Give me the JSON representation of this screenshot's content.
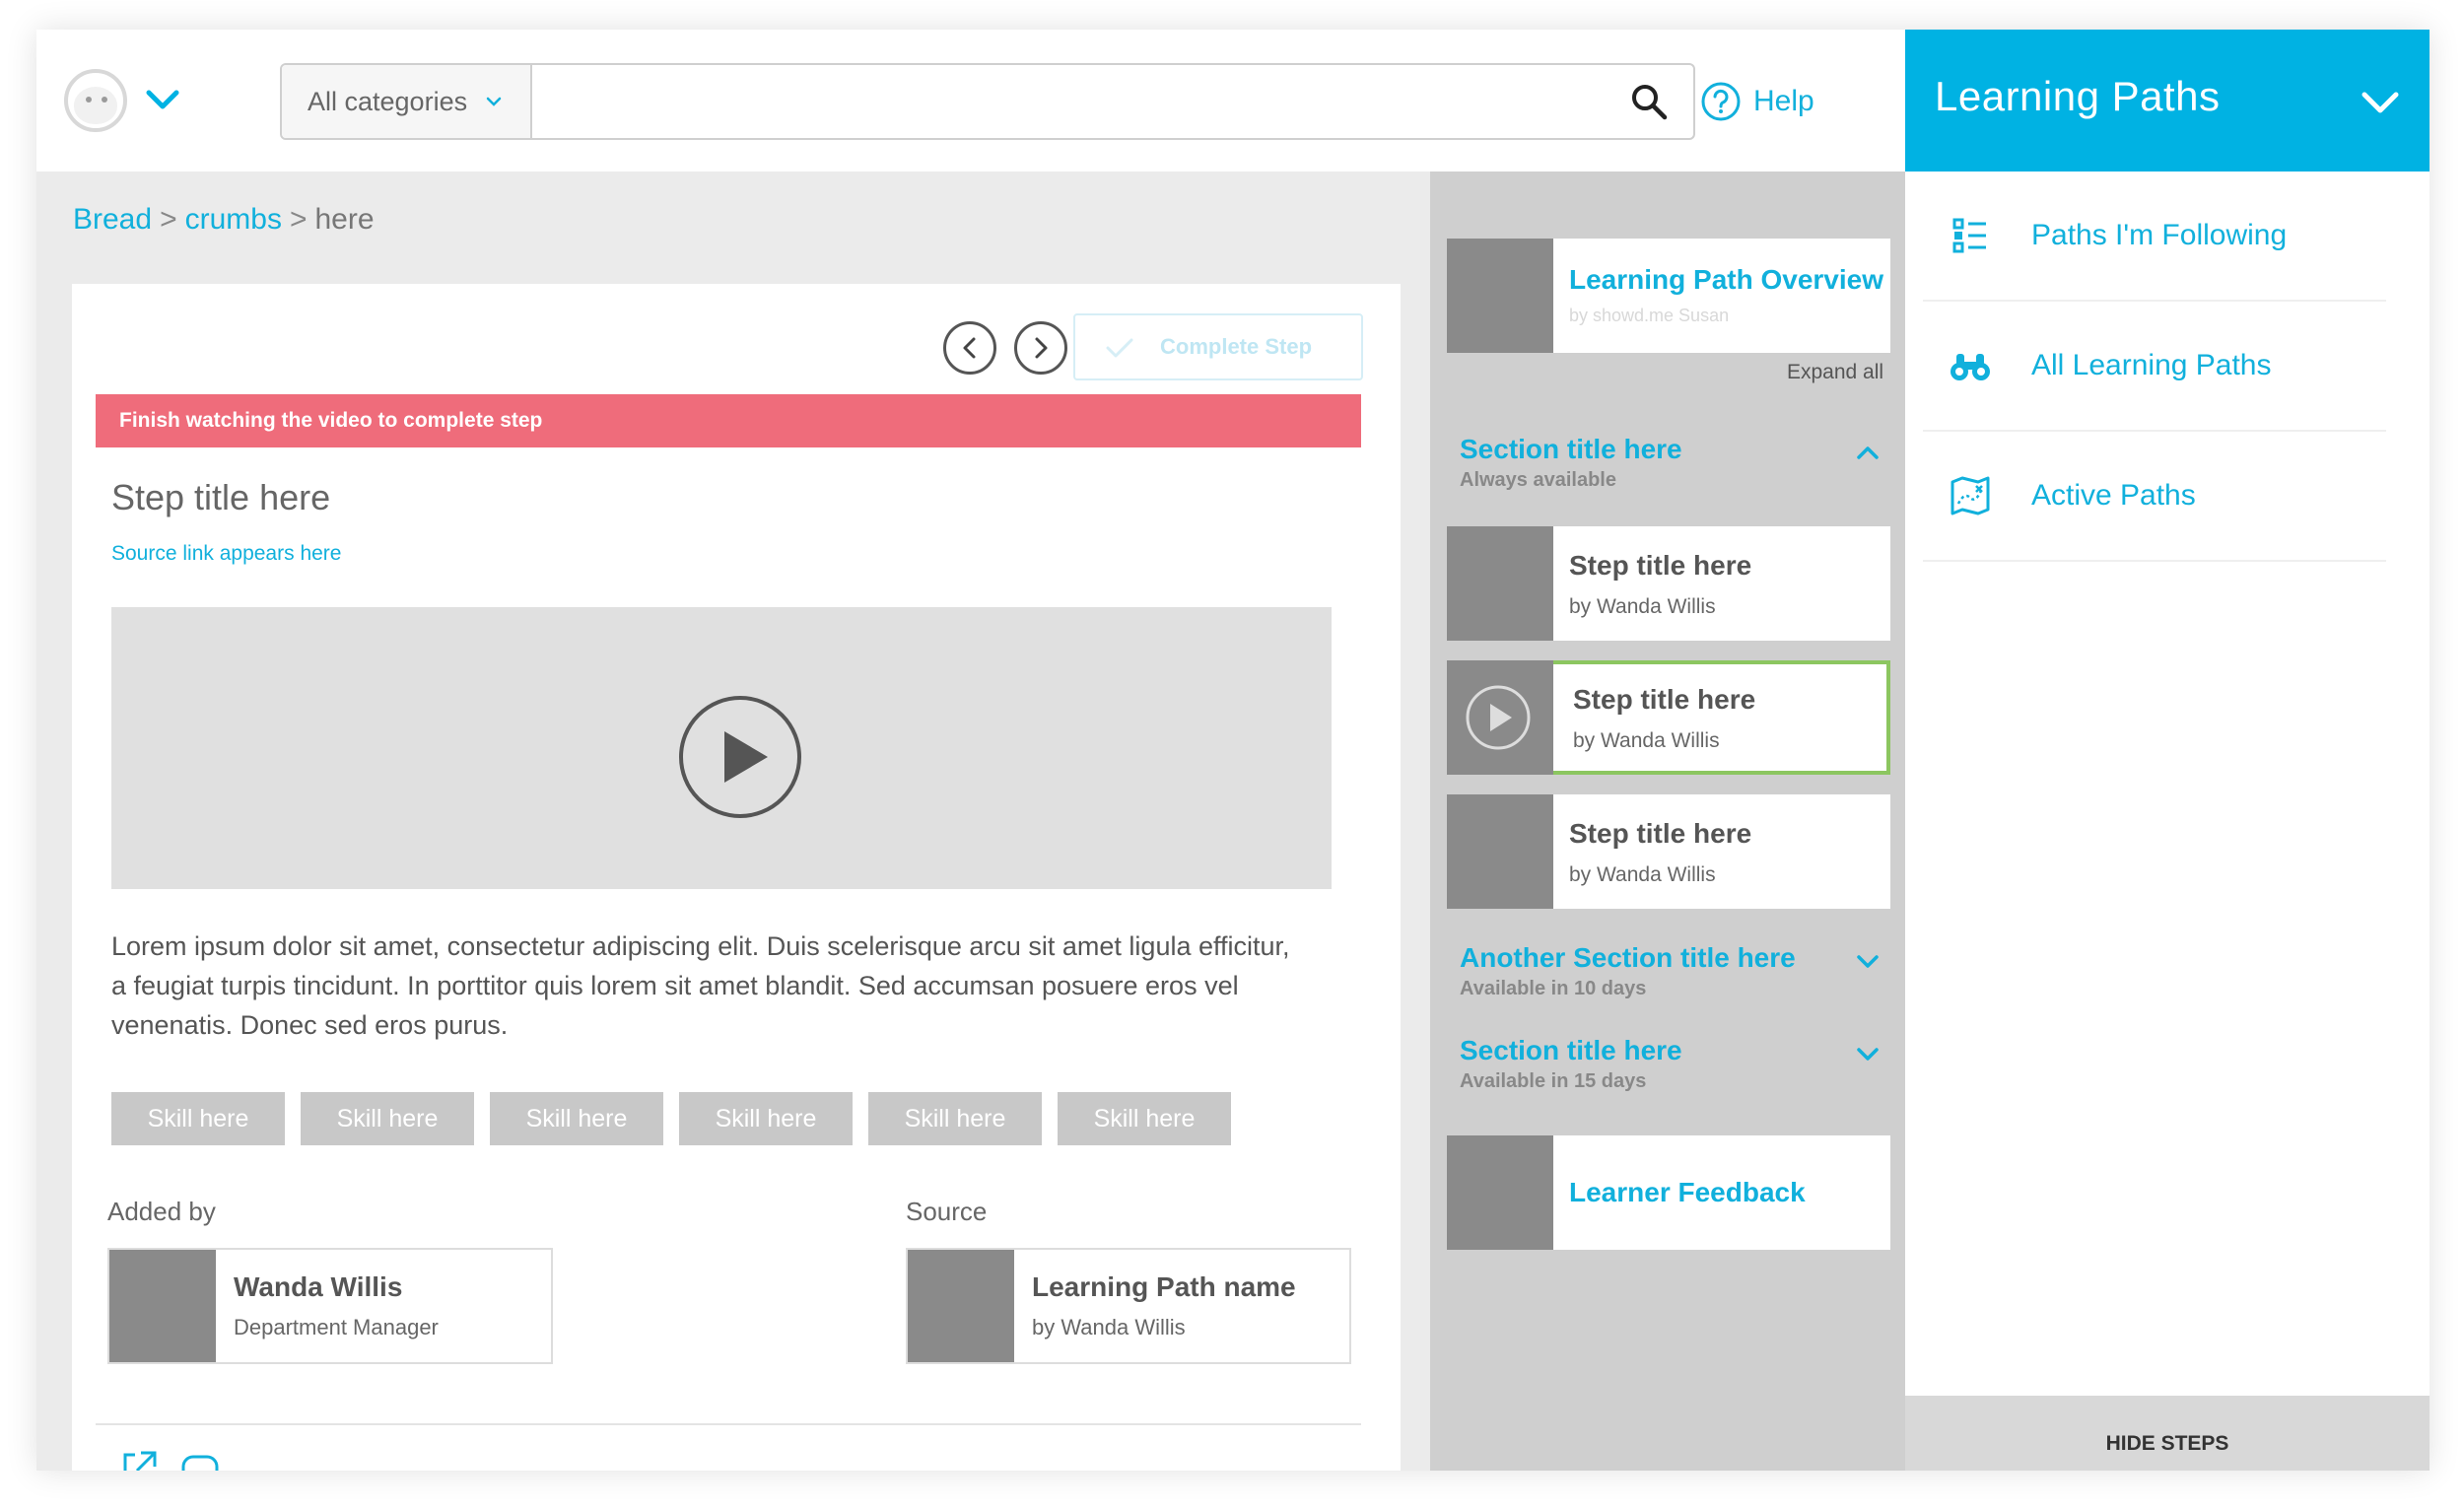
{
  "header": {
    "search": {
      "category": "All categories",
      "value": "",
      "placeholder": ""
    },
    "help_label": "Help"
  },
  "learning_paths": {
    "title": "Learning Paths",
    "nav": [
      {
        "label": "Paths I'm Following",
        "icon": "list-icon"
      },
      {
        "label": "All Learning Paths",
        "icon": "binoculars-icon"
      },
      {
        "label": "Active Paths",
        "icon": "map-icon"
      }
    ],
    "hide_steps": "HIDE STEPS"
  },
  "breadcrumb": {
    "items": [
      "Bread",
      "crumbs"
    ],
    "separator": ">",
    "current": "here"
  },
  "step": {
    "complete_label": "Complete Step",
    "alert": "Finish watching the video to complete step",
    "title": "Step title here",
    "source_link": "Source link appears here",
    "description": "Lorem ipsum dolor sit amet, consectetur adipiscing elit. Duis scelerisque arcu sit amet ligula efficitur, a feugiat turpis tincidunt. In porttitor quis lorem sit amet blandit. Sed accumsan posuere eros vel venenatis. Donec sed eros purus.",
    "skills": [
      "Skill here",
      "Skill here",
      "Skill here",
      "Skill here",
      "Skill here",
      "Skill here"
    ],
    "added_by_label": "Added by",
    "added_by": {
      "name": "Wanda Willis",
      "role": "Department Manager"
    },
    "source_label": "Source",
    "source": {
      "name": "Learning Path name",
      "by": "by Wanda Willis"
    }
  },
  "steps_panel": {
    "overview": {
      "title": "Learning Path Overview",
      "by": "by showd.me Susan"
    },
    "expand_all": "Expand all",
    "sections": [
      {
        "title": "Section title here",
        "availability": "Always available"
      },
      {
        "title": "Another Section title here",
        "availability": "Available in 10 days"
      },
      {
        "title": "Section title here",
        "availability": "Available in 15 days"
      }
    ],
    "steps": [
      {
        "title": "Step title here",
        "by": "by Wanda Willis"
      },
      {
        "title": "Step title here",
        "by": "by Wanda Willis"
      },
      {
        "title": "Step title here",
        "by": "by Wanda Willis"
      }
    ],
    "feedback": "Learner Feedback"
  },
  "colors": {
    "accent": "#00b2e3",
    "alert": "#ef6c7b",
    "active_border": "#8cc660"
  }
}
